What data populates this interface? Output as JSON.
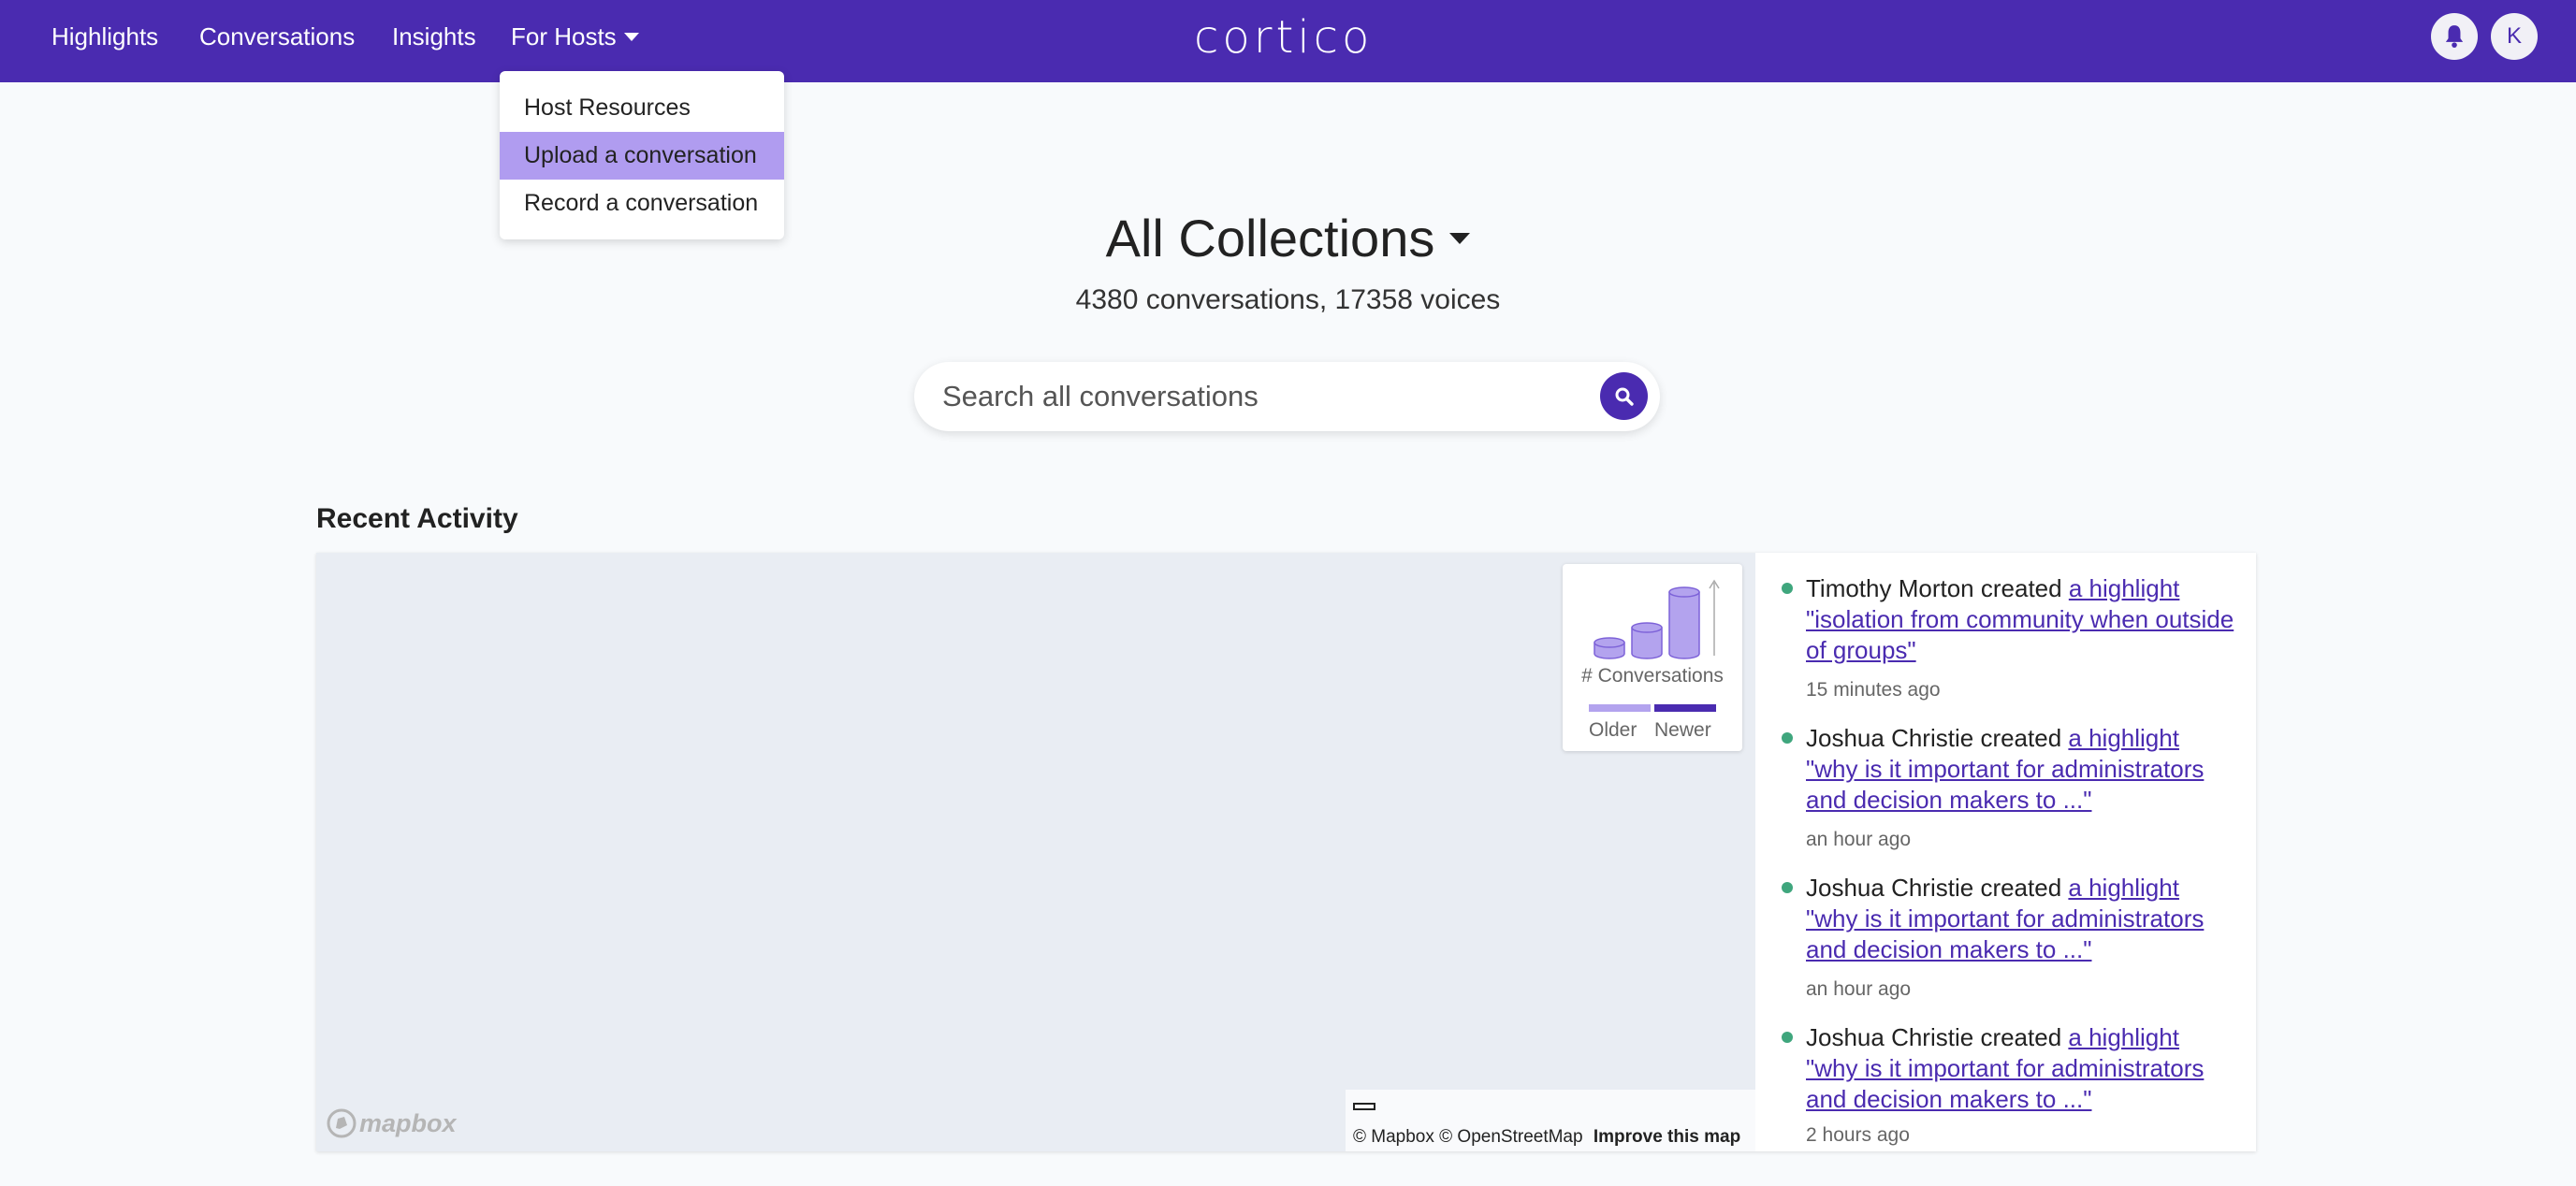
{
  "nav": {
    "items": [
      "Highlights",
      "Conversations",
      "Insights",
      "For Hosts"
    ],
    "logo": "cortico",
    "avatar_initial": "K",
    "brand_color": "#4a2bb0"
  },
  "dropdown": {
    "items": [
      "Host Resources",
      "Upload a conversation",
      "Record a conversation"
    ],
    "highlighted": "Upload a conversation"
  },
  "hero": {
    "title": "All Collections",
    "subtitle": "4380 conversations, 17358 voices"
  },
  "search": {
    "placeholder": "Search all conversations"
  },
  "recent": {
    "title": "Recent Activity",
    "legend": {
      "label": "# Conversations",
      "older": "Older",
      "newer": "Newer"
    },
    "map_brand": "mapbox",
    "attribution": {
      "mapbox": "© Mapbox",
      "osm": "© OpenStreetMap",
      "improve": "Improve this map"
    },
    "feed": [
      {
        "actor": "Timothy Morton",
        "verb": "created",
        "link": "a highlight \"isolation from community when outside of groups\"",
        "time": "15 minutes ago"
      },
      {
        "actor": "Joshua Christie",
        "verb": "created",
        "link": "a highlight \"why is it important for administrators and decision makers to ...\"",
        "time": "an hour ago"
      },
      {
        "actor": "Joshua Christie",
        "verb": "created",
        "link": "a highlight \"why is it important for administrators and decision makers to ...\"",
        "time": "an hour ago"
      },
      {
        "actor": "Joshua Christie",
        "verb": "created",
        "link": "a highlight \"why is it important for administrators and decision makers to ...\"",
        "time": "2 hours ago"
      }
    ]
  }
}
